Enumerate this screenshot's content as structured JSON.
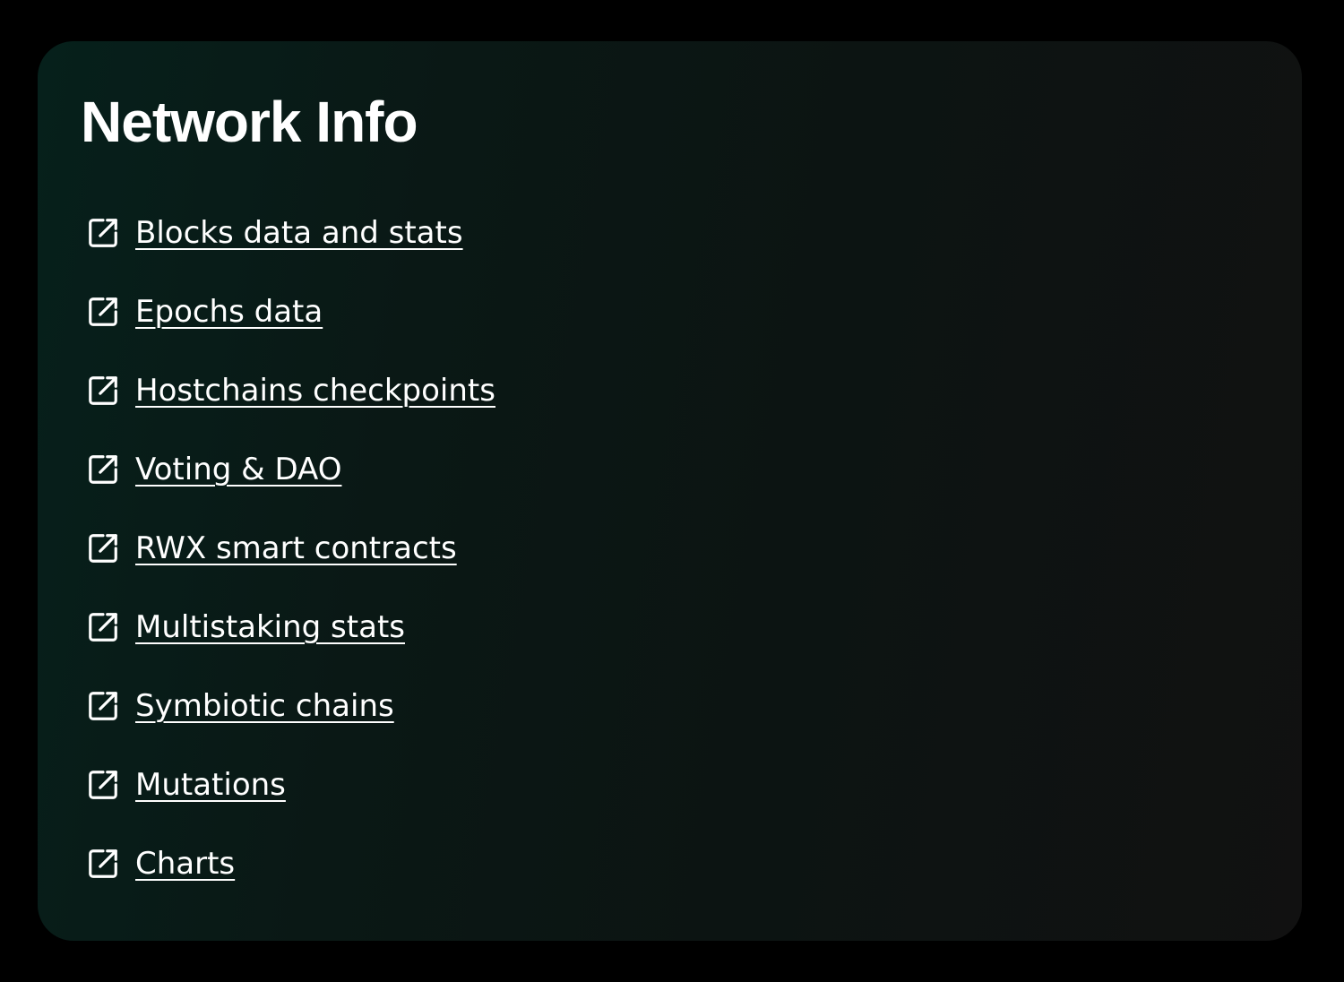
{
  "panel": {
    "title": "Network Info"
  },
  "links": [
    {
      "label": "Blocks data and stats",
      "icon": "external-link-icon"
    },
    {
      "label": "Epochs data",
      "icon": "external-link-icon"
    },
    {
      "label": "Hostchains checkpoints",
      "icon": "external-link-icon"
    },
    {
      "label": "Voting & DAO",
      "icon": "external-link-icon"
    },
    {
      "label": "RWX smart contracts",
      "icon": "external-link-icon"
    },
    {
      "label": "Multistaking stats",
      "icon": "external-link-icon"
    },
    {
      "label": "Symbiotic chains",
      "icon": "external-link-icon"
    },
    {
      "label": "Mutations",
      "icon": "external-link-icon"
    },
    {
      "label": "Charts",
      "icon": "external-link-icon"
    }
  ],
  "colors": {
    "page_background": "#000000",
    "card_gradient_start": "#06201b",
    "card_gradient_end": "#111111",
    "text": "#ffffff"
  }
}
